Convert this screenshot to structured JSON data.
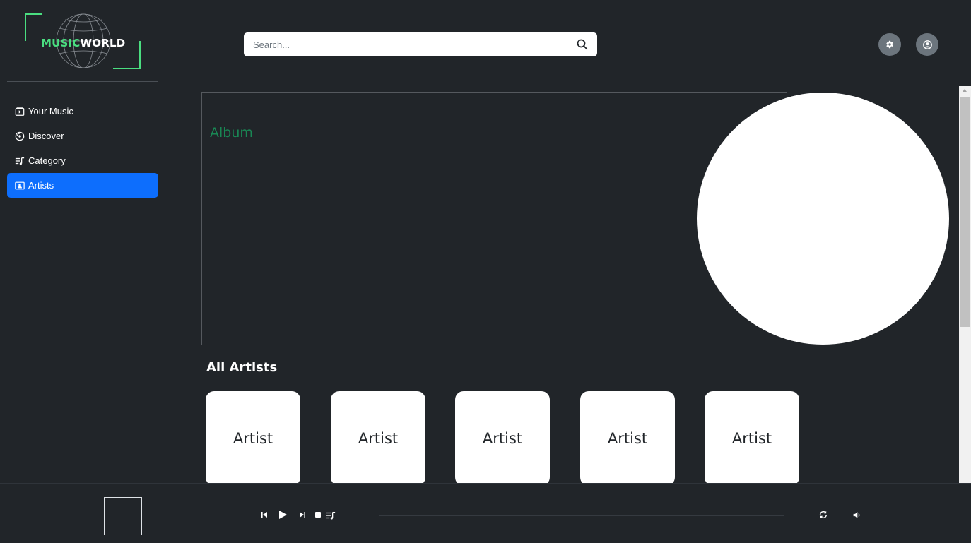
{
  "logo": {
    "part1": "MUSIC",
    "part2": "WORLD"
  },
  "search": {
    "placeholder": "Search..."
  },
  "sidebar": {
    "items": [
      {
        "label": "Your Music",
        "icon": "play-box-icon",
        "active": false
      },
      {
        "label": "Discover",
        "icon": "disc-icon",
        "active": false
      },
      {
        "label": "Category",
        "icon": "music-list-icon",
        "active": false
      },
      {
        "label": "Artists",
        "icon": "person-card-icon",
        "active": true
      }
    ]
  },
  "album": {
    "title": "Album",
    "subtitle": "."
  },
  "artists": {
    "title": "All Artists",
    "items": [
      {
        "label": "Artist"
      },
      {
        "label": "Artist"
      },
      {
        "label": "Artist"
      },
      {
        "label": "Artist"
      },
      {
        "label": "Artist"
      }
    ]
  },
  "colors": {
    "background": "#212529",
    "accent": "#0d6efd",
    "album_title": "#198754",
    "logo_green": "#4ade80"
  },
  "player": {
    "controls": [
      "skip-previous-icon",
      "play-icon",
      "skip-next-icon",
      "stop-icon",
      "queue-icon"
    ],
    "right_controls": [
      "repeat-icon",
      "volume-icon"
    ]
  }
}
